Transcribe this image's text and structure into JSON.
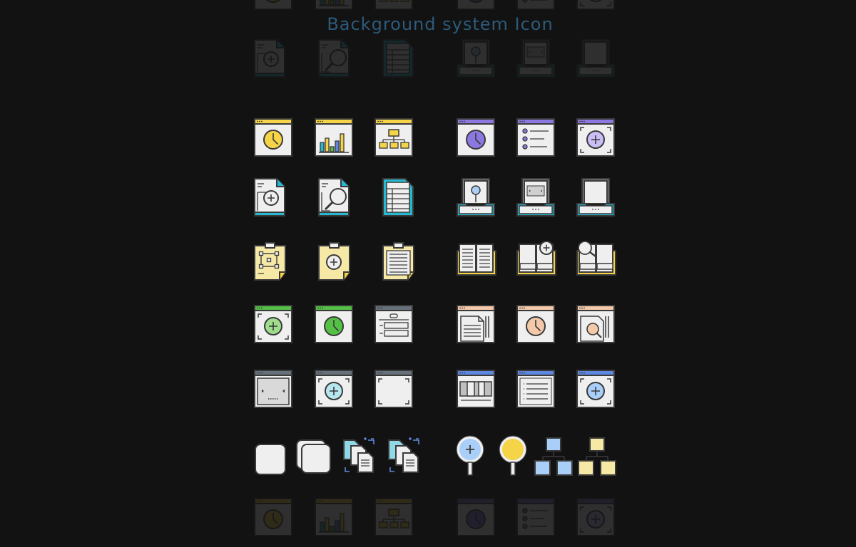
{
  "title": "Background system Icon",
  "colors": {
    "background": "#121212",
    "yellow": "#f5d447",
    "purple": "#8c78e0",
    "cyan": "#27b8d2",
    "green": "#54c146",
    "slate": "#66717c",
    "blue": "#5e87e0",
    "peach": "#f3c9a9",
    "paper": "#efefef",
    "outline": "#3a3a3a",
    "lightYellow": "#f6e9a6",
    "lightBlue": "#a9cef7",
    "lavender": "#cbbdf5",
    "lightGreen": "#9fdc8c",
    "tealLight": "#8fd8e6"
  },
  "icon_groups": [
    {
      "row": 1,
      "left": [
        "clock-window-icon",
        "bar-chart-window-icon",
        "org-chart-window-icon"
      ],
      "right": [
        "clock-window-icon",
        "checklist-window-icon",
        "add-window-icon"
      ]
    },
    {
      "row": 2,
      "left": [
        "add-document-icon",
        "search-document-icon",
        "table-document-icon"
      ],
      "right": [
        "tray-search-icon",
        "tray-slider-icon",
        "tray-empty-icon"
      ]
    },
    {
      "row": 3,
      "left": [
        "clipboard-frame-icon",
        "clipboard-add-icon",
        "clipboard-list-icon"
      ],
      "right": [
        "open-book-icon",
        "book-add-icon",
        "book-search-icon"
      ]
    },
    {
      "row": 4,
      "left": [
        "add-window-icon",
        "clock-window-icon",
        "form-window-icon"
      ],
      "right": [
        "documents-window-icon",
        "clock-window-icon",
        "search-docs-window-icon"
      ]
    },
    {
      "row": 5,
      "left": [
        "slider-window-icon",
        "add-window-icon",
        "frame-window-icon"
      ],
      "right": [
        "columns-window-icon",
        "list-window-icon",
        "add-window-icon"
      ]
    },
    {
      "row": 6,
      "left": [
        "square-card-icon",
        "stacked-cards-icon",
        "copy-files-icon",
        "copy-files-icon"
      ],
      "right": [
        "magnifier-add-icon",
        "magnifier-icon",
        "hierarchy-icon",
        "hierarchy-icon"
      ]
    }
  ]
}
